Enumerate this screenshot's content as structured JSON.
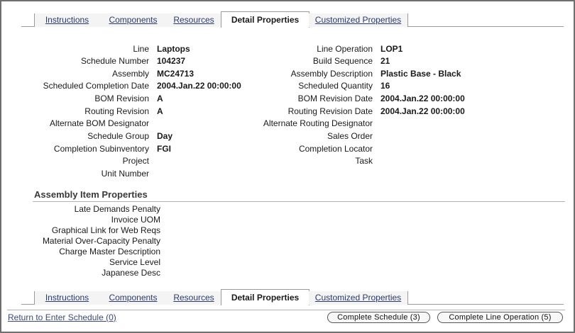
{
  "tabs": [
    {
      "label": "Instructions",
      "active": false
    },
    {
      "label": "Components",
      "active": false
    },
    {
      "label": "Resources",
      "active": false
    },
    {
      "label": "Detail Properties",
      "active": true
    },
    {
      "label": "Customized Properties",
      "active": false
    }
  ],
  "details_left": [
    {
      "label": "Line",
      "value": "Laptops"
    },
    {
      "label": "Schedule Number",
      "value": "104237"
    },
    {
      "label": "Assembly",
      "value": "MC24713"
    },
    {
      "label": "Scheduled Completion Date",
      "value": "2004.Jan.22 00:00:00"
    },
    {
      "label": "BOM Revision",
      "value": "A"
    },
    {
      "label": "Routing Revision",
      "value": "A"
    },
    {
      "label": "Alternate BOM Designator",
      "value": ""
    },
    {
      "label": "Schedule Group",
      "value": "Day"
    },
    {
      "label": "Completion Subinventory",
      "value": "FGI"
    },
    {
      "label": "Project",
      "value": ""
    },
    {
      "label": "Unit Number",
      "value": ""
    }
  ],
  "details_right": [
    {
      "label": "Line Operation",
      "value": "LOP1"
    },
    {
      "label": "Build Sequence",
      "value": "21"
    },
    {
      "label": "Assembly Description",
      "value": "Plastic Base - Black"
    },
    {
      "label": "Scheduled Quantity",
      "value": "16"
    },
    {
      "label": "BOM Revision Date",
      "value": "2004.Jan.22 00:00:00"
    },
    {
      "label": "Routing Revision Date",
      "value": "2004.Jan.22 00:00:00"
    },
    {
      "label": "Alternate Routing Designator",
      "value": ""
    },
    {
      "label": "Sales Order",
      "value": ""
    },
    {
      "label": "Completion Locator",
      "value": ""
    },
    {
      "label": "Task",
      "value": ""
    }
  ],
  "assembly_section": {
    "title": "Assembly Item Properties",
    "items": [
      {
        "label": "Late Demands Penalty",
        "value": ""
      },
      {
        "label": "Invoice UOM",
        "value": ""
      },
      {
        "label": "Graphical Link for Web Reqs",
        "value": ""
      },
      {
        "label": "Material Over-Capacity Penalty",
        "value": ""
      },
      {
        "label": "Charge Master Description",
        "value": ""
      },
      {
        "label": "Service Level",
        "value": ""
      },
      {
        "label": "Japanese Desc",
        "value": ""
      }
    ]
  },
  "footer": {
    "return_link": "Return to Enter Schedule (0)",
    "complete_schedule": "Complete Schedule (3)",
    "complete_line_operation": "Complete Line Operation (5)"
  }
}
